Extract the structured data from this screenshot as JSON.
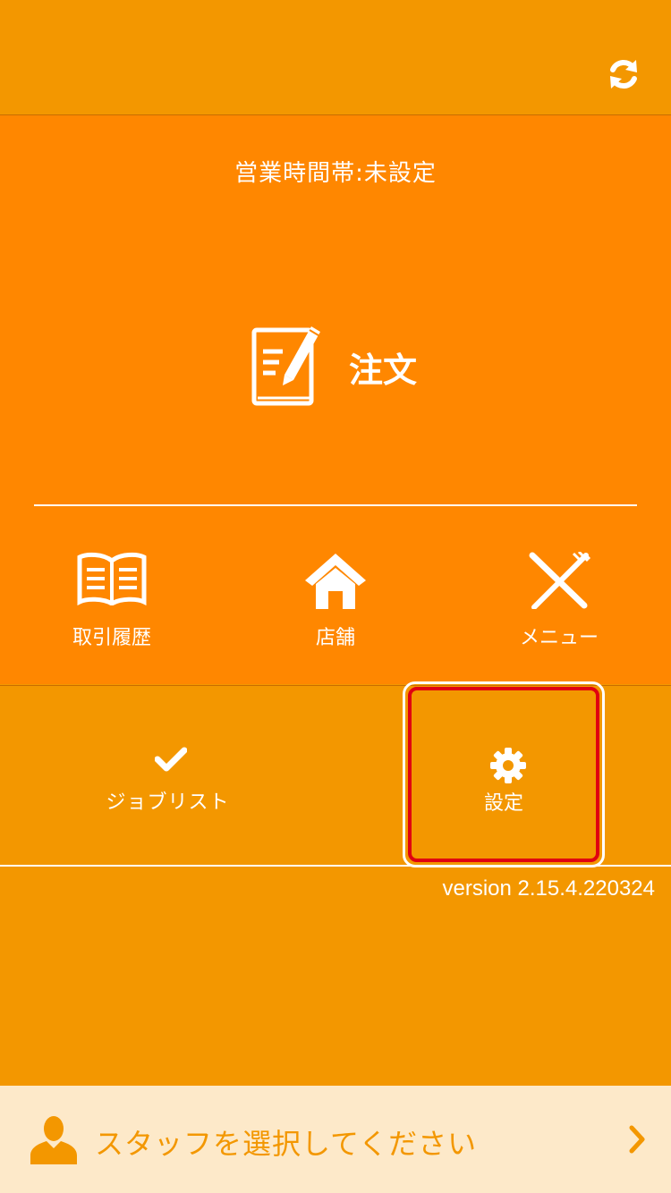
{
  "header": {
    "refresh_icon": "refresh-icon"
  },
  "main": {
    "business_hours": "営業時間帯:未設定",
    "order": {
      "label": "注文",
      "icon": "order-pad-icon"
    },
    "tiles": [
      {
        "label": "取引履歴",
        "icon": "book-icon"
      },
      {
        "label": "店舗",
        "icon": "home-icon"
      },
      {
        "label": "メニュー",
        "icon": "utensils-icon"
      }
    ]
  },
  "lower": {
    "jobs": {
      "label": "ジョブリスト",
      "icon": "check-icon"
    },
    "settings": {
      "label": "設定",
      "icon": "gear-icon"
    }
  },
  "version": "version 2.15.4.220324",
  "staff": {
    "prompt": "スタッフを選択してください",
    "icon": "person-icon"
  },
  "colors": {
    "background": "#f39700",
    "main_panel": "#ff8700",
    "staff_bar": "#fde9c9",
    "highlight": "#e00010"
  }
}
